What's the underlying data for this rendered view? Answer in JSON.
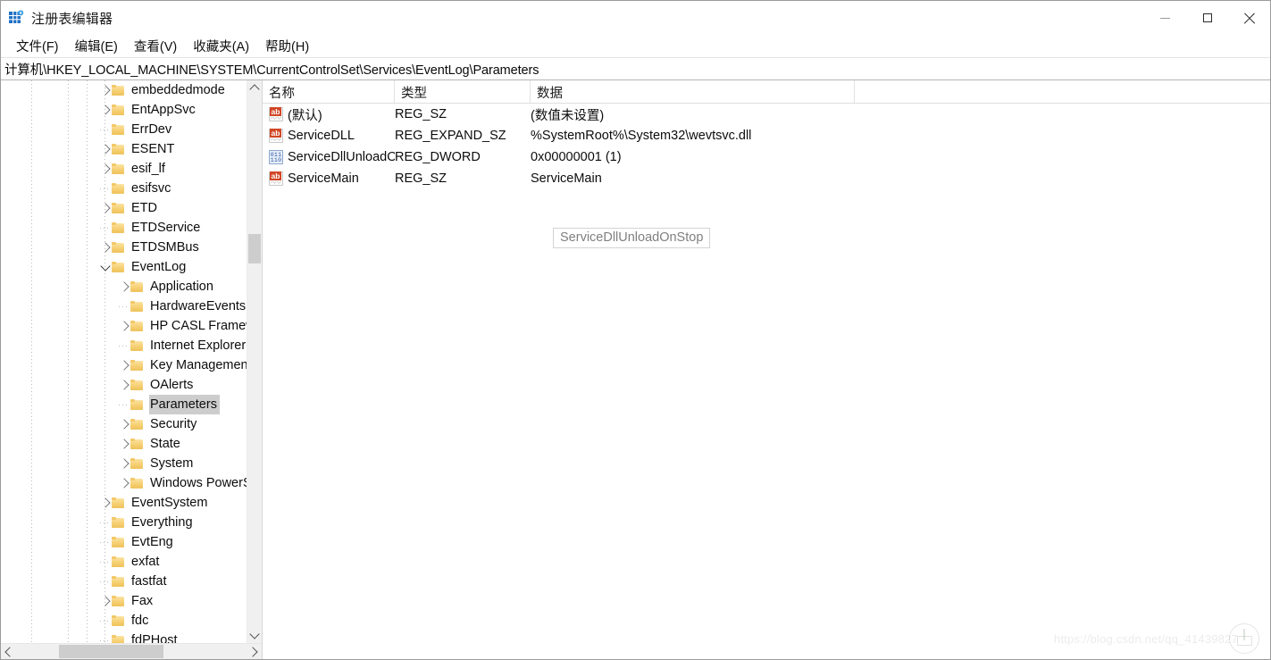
{
  "window": {
    "title": "注册表编辑器",
    "app_icon": "registry-icon",
    "controls": {
      "minimize": "minimize-icon",
      "maximize": "maximize-icon",
      "close": "close-icon"
    }
  },
  "menubar": {
    "items": [
      {
        "label": "文件(F)",
        "name": "menu-file"
      },
      {
        "label": "编辑(E)",
        "name": "menu-edit"
      },
      {
        "label": "查看(V)",
        "name": "menu-view"
      },
      {
        "label": "收藏夹(A)",
        "name": "menu-favorites"
      },
      {
        "label": "帮助(H)",
        "name": "menu-help"
      }
    ]
  },
  "address": {
    "path": "计算机\\HKEY_LOCAL_MACHINE\\SYSTEM\\CurrentControlSet\\Services\\EventLog\\Parameters"
  },
  "tree": {
    "items": [
      {
        "label": "embeddedmode",
        "depth": 1,
        "twisty": "collapsed",
        "clipped": true,
        "selected": false
      },
      {
        "label": "EntAppSvc",
        "depth": 1,
        "twisty": "collapsed",
        "clipped": false,
        "selected": false
      },
      {
        "label": "ErrDev",
        "depth": 1,
        "twisty": "none",
        "clipped": false,
        "selected": false
      },
      {
        "label": "ESENT",
        "depth": 1,
        "twisty": "collapsed",
        "clipped": false,
        "selected": false
      },
      {
        "label": "esif_lf",
        "depth": 1,
        "twisty": "collapsed",
        "clipped": false,
        "selected": false
      },
      {
        "label": "esifsvc",
        "depth": 1,
        "twisty": "none",
        "clipped": false,
        "selected": false
      },
      {
        "label": "ETD",
        "depth": 1,
        "twisty": "collapsed",
        "clipped": false,
        "selected": false
      },
      {
        "label": "ETDService",
        "depth": 1,
        "twisty": "none",
        "clipped": false,
        "selected": false
      },
      {
        "label": "ETDSMBus",
        "depth": 1,
        "twisty": "collapsed",
        "clipped": false,
        "selected": false
      },
      {
        "label": "EventLog",
        "depth": 1,
        "twisty": "expanded",
        "clipped": false,
        "selected": false
      },
      {
        "label": "Application",
        "depth": 2,
        "twisty": "collapsed",
        "clipped": false,
        "selected": false
      },
      {
        "label": "HardwareEvents",
        "depth": 2,
        "twisty": "none",
        "clipped": true,
        "selected": false
      },
      {
        "label": "HP CASL Framework",
        "depth": 2,
        "twisty": "collapsed",
        "clipped": true,
        "selected": false
      },
      {
        "label": "Internet Explorer",
        "depth": 2,
        "twisty": "none",
        "clipped": true,
        "selected": false
      },
      {
        "label": "Key Management Service",
        "depth": 2,
        "twisty": "collapsed",
        "clipped": true,
        "selected": false
      },
      {
        "label": "OAlerts",
        "depth": 2,
        "twisty": "collapsed",
        "clipped": false,
        "selected": false
      },
      {
        "label": "Parameters",
        "depth": 2,
        "twisty": "none",
        "clipped": false,
        "selected": true
      },
      {
        "label": "Security",
        "depth": 2,
        "twisty": "collapsed",
        "clipped": false,
        "selected": false
      },
      {
        "label": "State",
        "depth": 2,
        "twisty": "collapsed",
        "clipped": false,
        "selected": false
      },
      {
        "label": "System",
        "depth": 2,
        "twisty": "collapsed",
        "clipped": false,
        "selected": false
      },
      {
        "label": "Windows PowerShell",
        "depth": 2,
        "twisty": "collapsed",
        "clipped": true,
        "selected": false
      },
      {
        "label": "EventSystem",
        "depth": 1,
        "twisty": "collapsed",
        "clipped": false,
        "selected": false
      },
      {
        "label": "Everything",
        "depth": 1,
        "twisty": "none",
        "clipped": false,
        "selected": false
      },
      {
        "label": "EvtEng",
        "depth": 1,
        "twisty": "none",
        "clipped": false,
        "selected": false
      },
      {
        "label": "exfat",
        "depth": 1,
        "twisty": "none",
        "clipped": false,
        "selected": false
      },
      {
        "label": "fastfat",
        "depth": 1,
        "twisty": "none",
        "clipped": false,
        "selected": false
      },
      {
        "label": "Fax",
        "depth": 1,
        "twisty": "collapsed",
        "clipped": false,
        "selected": false
      },
      {
        "label": "fdc",
        "depth": 1,
        "twisty": "none",
        "clipped": false,
        "selected": false
      },
      {
        "label": "fdPHost",
        "depth": 1,
        "twisty": "none",
        "clipped": false,
        "selected": false
      }
    ],
    "vscroll": {
      "up": "scroll-up-icon",
      "down": "scroll-down-icon"
    },
    "hscroll": {
      "left": "scroll-left-icon",
      "right": "scroll-right-icon"
    }
  },
  "list": {
    "columns": [
      {
        "label": "名称",
        "name": "column-header-name"
      },
      {
        "label": "类型",
        "name": "column-header-type"
      },
      {
        "label": "数据",
        "name": "column-header-data"
      }
    ],
    "rows": [
      {
        "name": "(默认)",
        "icon": "string-value-icon",
        "type": "REG_SZ",
        "data": "(数值未设置)"
      },
      {
        "name": "ServiceDLL",
        "icon": "string-value-icon",
        "type": "REG_EXPAND_SZ",
        "data": "%SystemRoot%\\System32\\wevtsvc.dll"
      },
      {
        "name": "ServiceDllUnloadOnStop",
        "icon": "dword-value-icon",
        "type": "REG_DWORD",
        "data": "0x00000001 (1)"
      },
      {
        "name": "ServiceMain",
        "icon": "string-value-icon",
        "type": "REG_SZ",
        "data": "ServiceMain"
      }
    ]
  },
  "tooltip": {
    "text": "ServiceDllUnloadOnStop"
  },
  "watermark": {
    "text": "https://blog.csdn.net/qq_41439827",
    "logo": "csdn-logo-icon"
  },
  "colors": {
    "selection": "#cdcdcd",
    "folder": "#f6cf72",
    "string_icon": "#d24726",
    "dword_icon": "#2a57a5",
    "window_border": "#9b9b9b"
  }
}
